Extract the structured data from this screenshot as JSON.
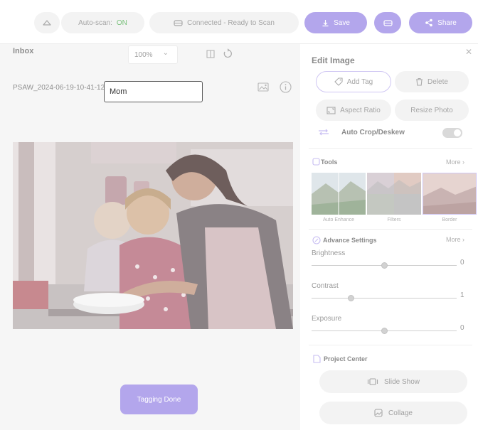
{
  "toolbar": {
    "autoscan_label": "Auto-scan:",
    "autoscan_state": "ON",
    "connection_status": "Connected - Ready to Scan",
    "save_label": "Save",
    "share_label": "Share"
  },
  "viewer": {
    "inbox_title": "Inbox",
    "zoom_value": "100%",
    "file_name": "PSAW_2024-06-19-10-41-12",
    "tag_input_value": "Mom",
    "tagging_done_label": "Tagging Done"
  },
  "edit_panel": {
    "title": "Edit Image",
    "add_tag_label": "Add Tag",
    "delete_label": "Delete",
    "aspect_ratio_label": "Aspect Ratio",
    "resize_label": "Resize Photo",
    "auto_crop_label": "Auto Crop/Deskew",
    "auto_crop_enabled": false,
    "tools_title": "Tools",
    "tools_more": "More",
    "tools": [
      {
        "label": "Auto Enhance"
      },
      {
        "label": "Filters"
      },
      {
        "label": "Border"
      }
    ],
    "advance_title": "Advance Settings",
    "advance_more": "More",
    "sliders": [
      {
        "label": "Brightness",
        "value": "0",
        "level": 0.5
      },
      {
        "label": "Contrast",
        "value": "1",
        "level": 0.27
      },
      {
        "label": "Exposure",
        "value": "0",
        "level": 0.5
      }
    ],
    "project_center_title": "Project Center",
    "slide_show_label": "Slide Show",
    "collage_label": "Collage"
  },
  "colors": {
    "accent": "#b3a6ec",
    "on_state": "#78c07a"
  }
}
